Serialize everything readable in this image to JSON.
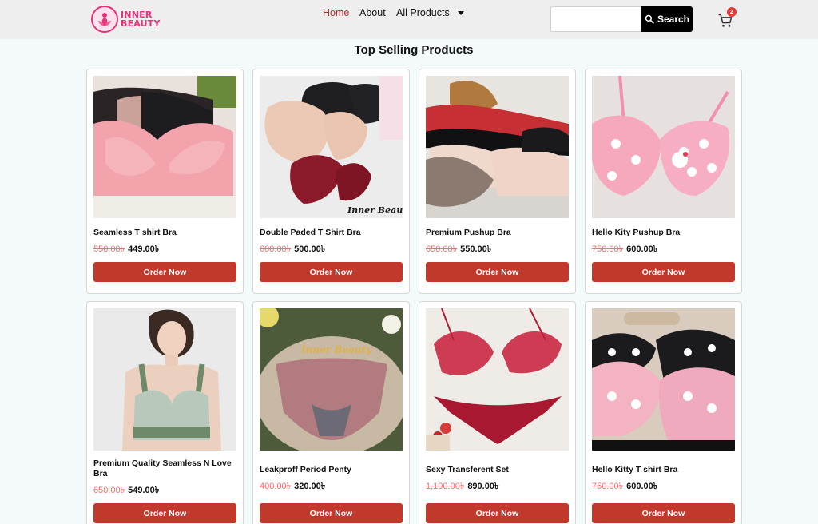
{
  "brand": {
    "line1": "INNER",
    "line2": "BEAUTY"
  },
  "nav": {
    "home": "Home",
    "about": "About",
    "products": "All Products"
  },
  "search": {
    "placeholder": "",
    "button": "Search"
  },
  "cart": {
    "count": "2"
  },
  "section_title": "Top Selling Products",
  "products": [
    {
      "name": "Seamless T shirt Bra",
      "old_price": "550.00৳",
      "new_price": "449.00৳",
      "button": "Order Now"
    },
    {
      "name": "Double Paded T Shirt Bra",
      "old_price": "600.00৳",
      "new_price": "500.00৳",
      "button": "Order Now",
      "watermark": "Inner Beauty"
    },
    {
      "name": "Premium Pushup Bra",
      "old_price": "650.00৳",
      "new_price": "550.00৳",
      "button": "Order Now"
    },
    {
      "name": "Hello Kity Pushup Bra",
      "old_price": "750.00৳",
      "new_price": "600.00৳",
      "button": "Order Now"
    },
    {
      "name": "Premium Quality Seamless N Love Bra",
      "old_price": "650.00৳",
      "new_price": "549.00৳",
      "button": "Order Now"
    },
    {
      "name": "Leakproff Period Penty",
      "old_price": "400.00৳",
      "new_price": "320.00৳",
      "button": "Order Now",
      "watermark": "Inner Beauty"
    },
    {
      "name": "Sexy Transferent Set",
      "old_price": "1,100.00৳",
      "new_price": "890.00৳",
      "button": "Order Now"
    },
    {
      "name": "Hello Kitty T shirt Bra",
      "old_price": "750.00৳",
      "new_price": "600.00৳",
      "button": "Order Now"
    }
  ],
  "colors": {
    "accent": "#c0392b",
    "nav_active": "#c62828",
    "brand": "#e8317a",
    "header_bg": "#eeeeee"
  },
  "icons": [
    "lotus-logo-icon",
    "caret-down-icon",
    "search-icon",
    "cart-icon"
  ]
}
